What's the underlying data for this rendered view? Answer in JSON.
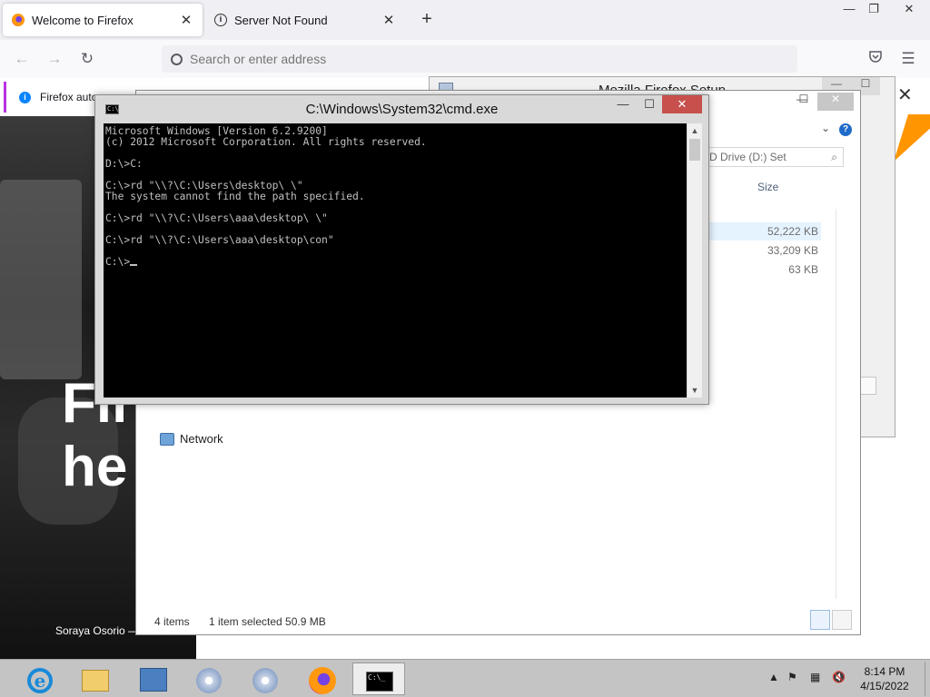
{
  "firefox": {
    "tabs": [
      {
        "title": "Welcome to Firefox",
        "active": true
      },
      {
        "title": "Server Not Found",
        "active": false
      }
    ],
    "new_tab_glyph": "+",
    "window_controls": {
      "minimize": "—",
      "maximize": "❐",
      "close": "✕"
    },
    "nav": {
      "back": "←",
      "forward": "→",
      "reload": "↻"
    },
    "url_placeholder": "Search or enter address",
    "notification": "Firefox auto",
    "hero_text": [
      "Fir",
      "he"
    ],
    "photo_credit": "Soraya Osorio —",
    "close_glyph": "✕"
  },
  "setup_window": {
    "title": "Mozilla Firefox Setup",
    "controls": {
      "minimize": "—",
      "maximize": "☐",
      "close": "✕"
    }
  },
  "explorer": {
    "controls": {
      "minimize": "—",
      "maximize": "☐",
      "close": "✕"
    },
    "search_placeholder": "D Drive (D:) Set",
    "column_size": "Size",
    "sizes": [
      "52,222 KB",
      "33,209 KB",
      "63 KB"
    ],
    "nav_network": "Network",
    "status_items": "4 items",
    "status_selected": "1 item selected  50.9 MB"
  },
  "cmd": {
    "title": "C:\\Windows\\System32\\cmd.exe",
    "controls": {
      "minimize": "—",
      "maximize": "☐",
      "close": "✕"
    },
    "lines": [
      "Microsoft Windows [Version 6.2.9200]",
      "(c) 2012 Microsoft Corporation. All rights reserved.",
      "",
      "D:\\>C:",
      "",
      "C:\\>rd \"\\\\?\\C:\\Users\\desktop\\ \\\"",
      "The system cannot find the path specified.",
      "",
      "C:\\>rd \"\\\\?\\C:\\Users\\aaa\\desktop\\ \\\"",
      "",
      "C:\\>rd \"\\\\?\\C:\\Users\\aaa\\desktop\\con\"",
      "",
      "C:\\>"
    ]
  },
  "taskbar": {
    "apps": [
      "internet-explorer",
      "file-explorer",
      "server-manager",
      "setup-disk-1",
      "setup-disk-2",
      "firefox",
      "command-prompt"
    ],
    "clock_time": "8:14 PM",
    "clock_date": "4/15/2022"
  },
  "colors": {
    "accent": "#1a8ad8",
    "cmd_close": "#c7504c",
    "firefox_notify": "#b833e1"
  }
}
